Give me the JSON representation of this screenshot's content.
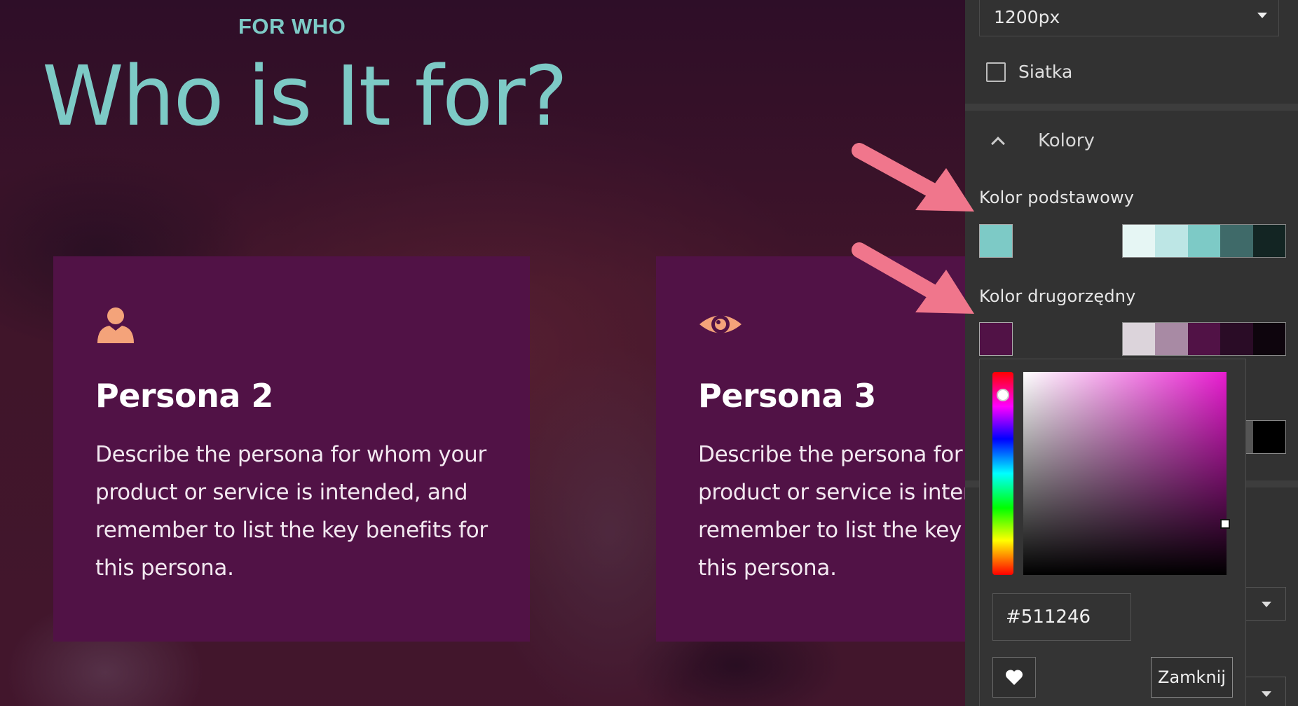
{
  "preview": {
    "kicker": "FOR WHO",
    "title": "Who is It for?",
    "cards": [
      {
        "icon": "person-icon",
        "title": "Persona 2",
        "text": "Describe the persona for whom your product or service is intended, and remember to list the key benefits for this persona."
      },
      {
        "icon": "eye-icon",
        "title": "Persona 3",
        "text": "Describe the persona for whom your product or service is intended, and remember to list the key benefits for this persona."
      }
    ]
  },
  "sidebar": {
    "width_value": "1200px",
    "grid_label": "Siatka",
    "grid_checked": false,
    "colors_section": "Kolory",
    "primary_label": "Kolor podstawowy",
    "primary_color": "#7dcac6",
    "primary_shades": [
      "#e6f6f4",
      "#bde6e5",
      "#7dcac6",
      "#3f6a69",
      "#132523"
    ],
    "secondary_label": "Kolor drugorzędny",
    "secondary_color": "#511246",
    "secondary_shades": [
      "#dcd4db",
      "#a88aa4",
      "#511246",
      "#2a0c26",
      "#0e050d"
    ]
  },
  "picker": {
    "hex_value": "#511246",
    "close_label": "Zamknij"
  },
  "colors": {
    "accent": "#7dcac6",
    "card_bg": "#511246",
    "icon_orange": "#f4a37a",
    "arrow_pink": "#f0768c"
  }
}
